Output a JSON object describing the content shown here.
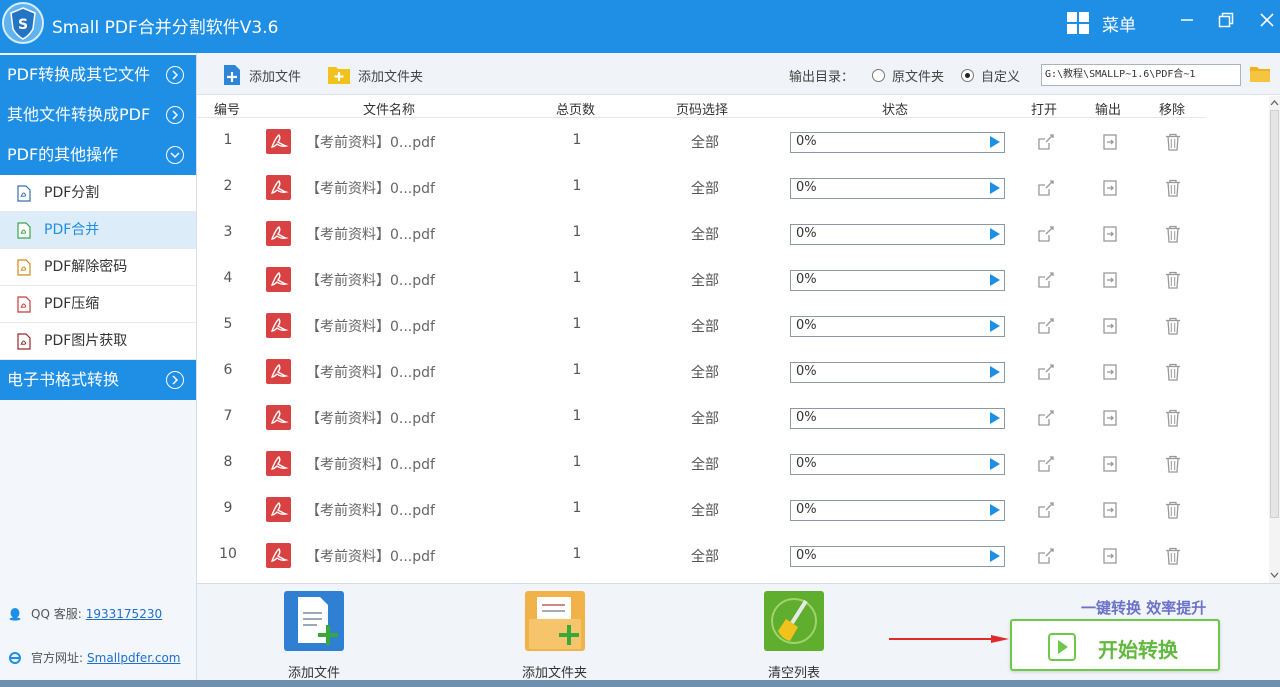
{
  "window": {
    "title": "Small PDF合并分割软件V3.6",
    "menu_label": "菜单"
  },
  "sidebar": {
    "categories": [
      {
        "label": "PDF转换成其它文件"
      },
      {
        "label": "其他文件转换成PDF"
      },
      {
        "label": "PDF的其他操作"
      },
      {
        "label": "电子书格式转换"
      }
    ],
    "items": [
      {
        "label": "PDF分割",
        "icon": "pdf-split-icon"
      },
      {
        "label": "PDF合并",
        "icon": "pdf-merge-icon",
        "active": true
      },
      {
        "label": "PDF解除密码",
        "icon": "pdf-unlock-icon"
      },
      {
        "label": "PDF压缩",
        "icon": "pdf-compress-icon"
      },
      {
        "label": "PDF图片获取",
        "icon": "pdf-image-icon"
      }
    ],
    "qq_label": "QQ 客服:",
    "qq_number": "1933175230",
    "site_label": "官方网址:",
    "site_url": "Smallpdfer.com"
  },
  "toolbar": {
    "add_file": "添加文件",
    "add_folder": "添加文件夹",
    "output_dir_label": "输出目录：",
    "radio_original": "原文件夹",
    "radio_custom": "自定义",
    "output_path": "G:\\教程\\SMALLP~1.6\\PDF合~1"
  },
  "table": {
    "headers": {
      "index": "编号",
      "filename": "文件名称",
      "pages": "总页数",
      "page_select": "页码选择",
      "status": "状态",
      "open": "打开",
      "output": "输出",
      "remove": "移除"
    },
    "rows": [
      {
        "index": "1",
        "filename": "【考前资料】0...pdf",
        "pages": "1",
        "page_select": "全部",
        "progress": 0,
        "status": "0%"
      },
      {
        "index": "2",
        "filename": "【考前资料】0...pdf",
        "pages": "1",
        "page_select": "全部",
        "progress": 0,
        "status": "0%"
      },
      {
        "index": "3",
        "filename": "【考前资料】0...pdf",
        "pages": "1",
        "page_select": "全部",
        "progress": 0,
        "status": "0%"
      },
      {
        "index": "4",
        "filename": "【考前资料】0...pdf",
        "pages": "1",
        "page_select": "全部",
        "progress": 0,
        "status": "0%"
      },
      {
        "index": "5",
        "filename": "【考前资料】0...pdf",
        "pages": "1",
        "page_select": "全部",
        "progress": 0,
        "status": "0%"
      },
      {
        "index": "6",
        "filename": "【考前资料】0...pdf",
        "pages": "1",
        "page_select": "全部",
        "progress": 0,
        "status": "0%"
      },
      {
        "index": "7",
        "filename": "【考前资料】0...pdf",
        "pages": "1",
        "page_select": "全部",
        "progress": 0,
        "status": "0%"
      },
      {
        "index": "8",
        "filename": "【考前资料】0...pdf",
        "pages": "1",
        "page_select": "全部",
        "progress": 0,
        "status": "0%"
      },
      {
        "index": "9",
        "filename": "【考前资料】0...pdf",
        "pages": "1",
        "page_select": "全部",
        "progress": 0,
        "status": "0%"
      },
      {
        "index": "10",
        "filename": "【考前资料】0...pdf",
        "pages": "1",
        "page_select": "全部",
        "progress": 0,
        "status": "0%"
      }
    ]
  },
  "bottom": {
    "add_file": "添加文件",
    "add_folder": "添加文件夹",
    "clear_list": "清空列表",
    "slogan": "一键转换  效率提升",
    "start": "开始转换"
  },
  "colors": {
    "primary": "#1e8fe4",
    "start_green": "#6ec84a",
    "pdf_red": "#d94242",
    "slogan": "#6b73c8"
  }
}
